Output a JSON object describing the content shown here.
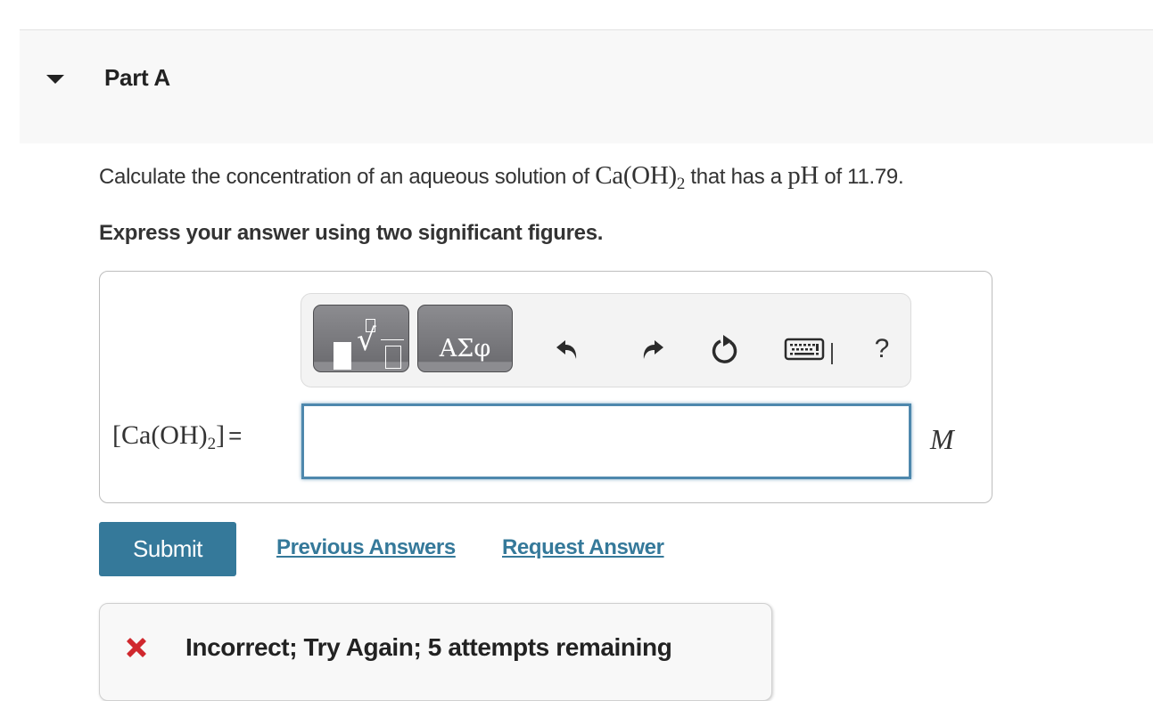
{
  "part": {
    "title": "Part A",
    "collapse_icon": "caret-down-icon"
  },
  "question": {
    "prefix": "Calculate the concentration of an aqueous solution of ",
    "compound_main": "Ca(OH)",
    "compound_sub": "2",
    "middle": " that has a ",
    "ph_symbol": "pH",
    "suffix": " of 11.79."
  },
  "instruction": "Express your answer using two significant figures.",
  "toolbar": {
    "templates_button": "templates-icon",
    "symbols_label": "ΑΣφ",
    "undo_icon": "undo-icon",
    "redo_icon": "redo-icon",
    "reset_icon": "reset-icon",
    "keyboard_icon": "keyboard-icon",
    "help_label": "?"
  },
  "answer": {
    "label_open": "[Ca(OH)",
    "label_sub": "2",
    "label_close": "]",
    "equals": "=",
    "value": "",
    "unit": "M"
  },
  "actions": {
    "submit_label": "Submit",
    "previous_answers_label": "Previous Answers",
    "request_answer_label": "Request Answer"
  },
  "feedback": {
    "icon": "incorrect-x-icon",
    "text": "Incorrect; Try Again; 5 attempts remaining",
    "icon_color": "#d0282e"
  },
  "colors": {
    "accent": "#35799a",
    "input_border": "#4e88ad"
  }
}
